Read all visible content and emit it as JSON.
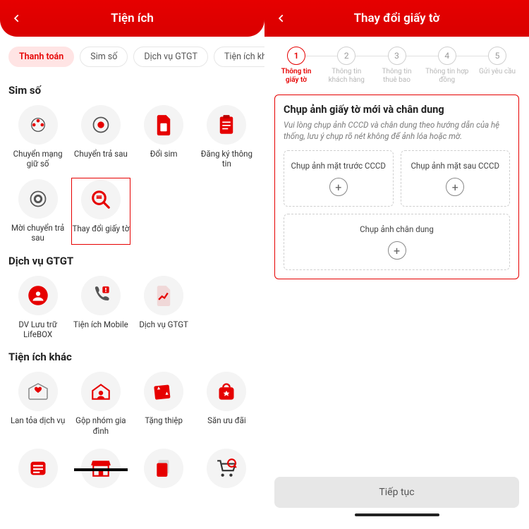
{
  "left": {
    "header_title": "Tiện ích",
    "tabs": [
      "Thanh toán",
      "Sim số",
      "Dịch vụ GTGT",
      "Tiện ích kh"
    ],
    "active_tab_index": 0,
    "sections": {
      "sim": {
        "title": "Sim số",
        "items": [
          {
            "label": "Chuyển mạng giữ số",
            "icon": "transfer"
          },
          {
            "label": "Chuyển trả sau",
            "icon": "circle-arrows"
          },
          {
            "label": "Đổi sim",
            "icon": "sim"
          },
          {
            "label": "Đăng ký thông tin",
            "icon": "clipboard"
          },
          {
            "label": "Mời chuyển trả sau",
            "icon": "circle-arrows"
          },
          {
            "label": "Thay đổi giấy tờ",
            "icon": "search",
            "highlight": true
          }
        ]
      },
      "gtgt": {
        "title": "Dịch vụ GTGT",
        "items": [
          {
            "label": "DV Lưu trữ LifeBOX",
            "icon": "lifebox"
          },
          {
            "label": "Tiện ích Mobile",
            "icon": "phone"
          },
          {
            "label": "Dịch vụ GTGT",
            "icon": "doc"
          }
        ]
      },
      "khac": {
        "title": "Tiện ích khác",
        "items": [
          {
            "label": "Lan tỏa dịch vụ",
            "icon": "heart-mail"
          },
          {
            "label": "Gộp nhóm gia đình",
            "icon": "family"
          },
          {
            "label": "Tặng thiệp",
            "icon": "gift-card"
          },
          {
            "label": "Săn ưu đãi",
            "icon": "bag"
          }
        ]
      },
      "bottom_row": [
        {
          "icon": "list"
        },
        {
          "icon": "store"
        },
        {
          "icon": "docs"
        },
        {
          "icon": "cart"
        }
      ]
    }
  },
  "right": {
    "header_title": "Thay đổi giấy tờ",
    "steps": [
      {
        "num": "1",
        "label": "Thông tin giấy tờ",
        "active": true
      },
      {
        "num": "2",
        "label": "Thông tin khách hàng"
      },
      {
        "num": "3",
        "label": "Thông tin thuê bao"
      },
      {
        "num": "4",
        "label": "Thông tin hợp đồng"
      },
      {
        "num": "5",
        "label": "Gửi yêu cầu"
      }
    ],
    "card": {
      "title": "Chụp ảnh giấy tờ mới và chân dung",
      "subtitle": "Vui lòng chụp ảnh CCCD và chân dung theo hướng dẫn của hệ thống, lưu ý chụp rõ nét không để ảnh lóa hoặc mờ.",
      "upload_front": "Chụp ảnh mặt trước CCCD",
      "upload_back": "Chụp ảnh mặt sau CCCD",
      "upload_portrait": "Chụp ảnh chân dung"
    },
    "continue_btn": "Tiếp tục"
  }
}
